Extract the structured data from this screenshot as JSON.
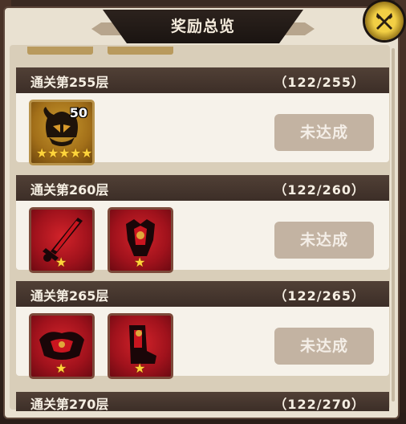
{
  "window": {
    "title": "奖励总览"
  },
  "sections": [
    {
      "title": "通关第255层",
      "progress": "（122/255）",
      "status": "未达成",
      "items": [
        {
          "type": "gold-helmet",
          "count": "50",
          "stars": 5
        }
      ]
    },
    {
      "title": "通关第260层",
      "progress": "（122/260）",
      "status": "未达成",
      "items": [
        {
          "type": "red-sword",
          "stars": 1
        },
        {
          "type": "red-armor",
          "stars": 1
        }
      ]
    },
    {
      "title": "通关第265层",
      "progress": "（122/265）",
      "status": "未达成",
      "items": [
        {
          "type": "red-pauldron",
          "stars": 1
        },
        {
          "type": "red-boots",
          "stars": 1
        }
      ]
    },
    {
      "title": "通关第270层",
      "progress": "（122/270）"
    }
  ],
  "icons": {
    "close": "crossed-axes-icon"
  },
  "colors": {
    "accent": "#f2cf45",
    "header": "#473830",
    "button": "#c3b3a2",
    "item_red": "#b51520",
    "item_gold": "#a9751c"
  }
}
